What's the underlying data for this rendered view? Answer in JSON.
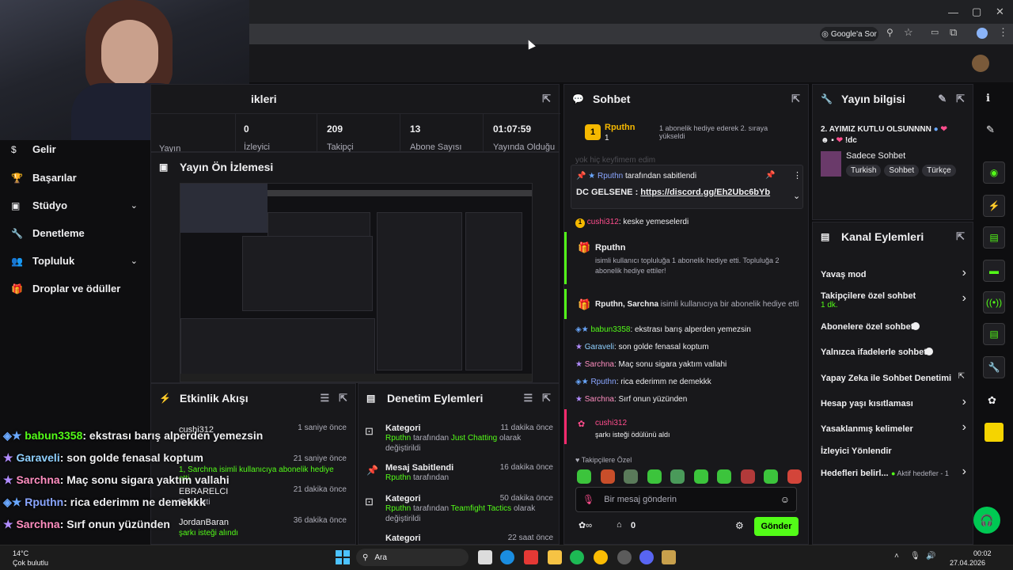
{
  "browser": {
    "google_btn": "Google'a Sor"
  },
  "sidebar": {
    "items": [
      {
        "label": "Gelir",
        "icon": "dollar-icon"
      },
      {
        "label": "Başarılar",
        "icon": "trophy-icon"
      },
      {
        "label": "Stüdyo",
        "icon": "studio-icon"
      },
      {
        "label": "Denetleme",
        "icon": "wrench-icon"
      },
      {
        "label": "Topluluk",
        "icon": "people-icon"
      },
      {
        "label": "Droplar ve ödüller",
        "icon": "gift-icon"
      }
    ]
  },
  "stats": {
    "title": "ikleri",
    "items": [
      {
        "value": "0",
        "label": "İzleyici"
      },
      {
        "value": "209",
        "label": "Takipçi"
      },
      {
        "value": "13",
        "label": "Abone Sayısı"
      },
      {
        "value": "01:07:59",
        "label": "Yayında Olduğu"
      }
    ],
    "partial_label": "Yayın"
  },
  "preview": {
    "title": "Yayın Ön İzlemesi"
  },
  "activity": {
    "title": "Etkinlik Akışı",
    "items": [
      {
        "user": "cushi312",
        "time": "1 saniye önce",
        "desc": "şarkı isteği aldı"
      },
      {
        "user": "Sarchna",
        "time": "21 saniye önce",
        "desc": "1, Sarchna isimli kullanıcıya abonelik hediye etti."
      },
      {
        "user": "EBRARELCI",
        "time": "21 dakika önce",
        "desc": "Takip etti"
      },
      {
        "user": "JordanBaran",
        "time": "36 dakika önce",
        "desc": "şarkı isteği alındı"
      }
    ]
  },
  "overlay_chat": [
    {
      "user": "babun3358",
      "text": ": ekstrası barış alperden yemezsin"
    },
    {
      "user": "Garaveli",
      "text": ": son golde fenasal koptum"
    },
    {
      "user": "Sarchna",
      "text": ": Maç sonu sigara yaktım vallahi"
    },
    {
      "user": "Rputhn",
      "text": ": rica ederimm ne demekkk"
    },
    {
      "user": "Sarchna",
      "text": ": Sırf onun yüzünden"
    }
  ],
  "moderation": {
    "title": "Denetim Eylemleri",
    "items": [
      {
        "type": "Kategori",
        "time": "11 dakika önce",
        "user": "Rputhn",
        "mid": " tarafından ",
        "target": "Just Chatting",
        "suffix": " olarak değiştirildi"
      },
      {
        "type": "Mesaj Sabitlendi",
        "time": "16 dakika önce",
        "user": "Rputhn",
        "mid": " tarafından",
        "target": "",
        "suffix": ""
      },
      {
        "type": "Kategori",
        "time": "50 dakika önce",
        "user": "Rputhn",
        "mid": " tarafından ",
        "target": "Teamfight Tactics",
        "suffix": " olarak değiştirildi"
      },
      {
        "type": "Kategori",
        "time": "22 saat önce",
        "user": "",
        "mid": "",
        "target": "",
        "suffix": ""
      }
    ]
  },
  "chat": {
    "title": "Sohbet",
    "top_gifter": {
      "rank": "1",
      "name": "Rputhn",
      "count": "1",
      "note": "1 abonelik hediye ederek 2. sıraya yükseldi"
    },
    "hidden_line": "yok hiç keyfimem edim",
    "pinned": {
      "by": "Rputhn",
      "by_suffix": " tarafından sabitlendi",
      "prefix": "DC GELSENE : ",
      "link": "https://discord.gg/Eh2Ubc6bYb"
    },
    "messages": [
      {
        "user": "cushi312",
        "text": ": keske yemeselerdi"
      },
      {
        "user": "babun3358",
        "text": ": ekstrası barış alperden yemezsin"
      },
      {
        "user": "Garaveli",
        "text": ": son golde fenasal koptum"
      },
      {
        "user": "Sarchna",
        "text": ": Maç sonu sigara yaktım vallahi"
      },
      {
        "user": "Rputhn",
        "text": ": rica ederimm ne demekkk"
      },
      {
        "user": "Sarchna",
        "text": ": Sırf onun yüzünden"
      }
    ],
    "gift_event": {
      "user": "Rputhn",
      "text": "isimli kullanıcı topluluğa 1 abonelik hediye etti. Topluluğa 2 abonelik hediye ettiler!"
    },
    "gift_event2": {
      "users": "Rputhn, Sarchna",
      "text": " isimli kullanıcıya bir abonelik hediye etti"
    },
    "reward": {
      "user": "cushi312",
      "text": "şarkı isteği ödülünü aldı"
    },
    "followers_only": "Takipçilere Özel",
    "input_placeholder": "Bir mesaj gönderin",
    "points": "0",
    "send": "Gönder"
  },
  "stream_info": {
    "title": "Yayın bilgisi",
    "stream_title": "2. AYIMIZ KUTLU OLSUNNNN",
    "stream_title2": "!dc",
    "category": "Sadece Sohbet",
    "tags": [
      "Turkish",
      "Sohbet",
      "Türkçe"
    ]
  },
  "channel_actions": {
    "title": "Kanal Eylemleri",
    "items": [
      {
        "label": "Yavaş mod",
        "sub": "",
        "control": "chevron"
      },
      {
        "label": "Takipçilere özel sohbet",
        "sub": "1 dk.",
        "control": "chevron"
      },
      {
        "label": "Abonelere özel sohbet",
        "sub": "",
        "control": "toggle"
      },
      {
        "label": "Yalnızca ifadelerle sohbet",
        "sub": "",
        "control": "toggle"
      },
      {
        "label": "Yapay Zeka ile Sohbet Denetimi",
        "sub": "",
        "control": "external"
      },
      {
        "label": "Hesap yaşı kısıtlaması",
        "sub": "",
        "control": "chevron"
      },
      {
        "label": "Yasaklanmış kelimeler",
        "sub": "",
        "control": "chevron"
      },
      {
        "label": "İzleyici Yönlendir",
        "sub": "",
        "control": "none"
      }
    ],
    "goals_label": "Hedefleri belirl...",
    "goals_active": "Aktif hedefler - 1"
  },
  "taskbar": {
    "weather_temp": "14°C",
    "weather_desc": "Çok bulutlu",
    "search": "Ara",
    "time": "00:02",
    "date": "27.04.2026"
  },
  "colors": {
    "accent": "#53fc18",
    "bg": "#0e0e10",
    "panel": "#18181b"
  }
}
